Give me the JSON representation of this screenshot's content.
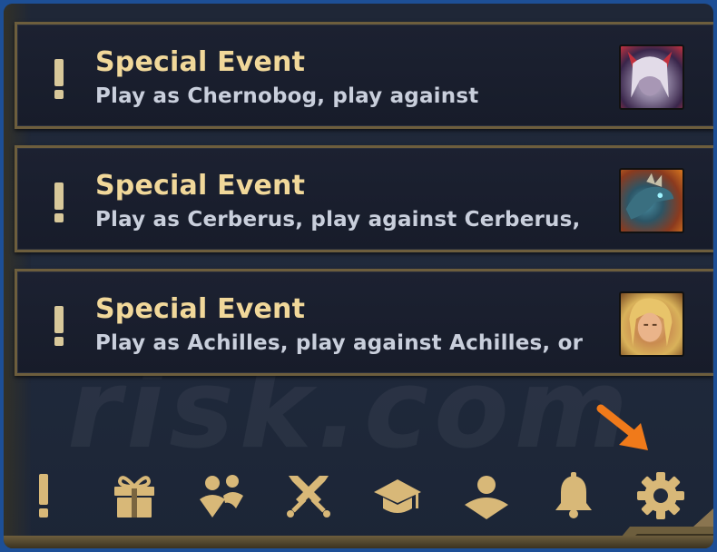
{
  "events": [
    {
      "title": "Special Event",
      "description": "Play as Chernobog, play against",
      "portrait": "chernobog-portrait"
    },
    {
      "title": "Special Event",
      "description": "Play as Cerberus, play against Cerberus,",
      "portrait": "cerberus-portrait"
    },
    {
      "title": "Special Event",
      "description": "Play as Achilles, play against Achilles, or",
      "portrait": "achilles-portrait"
    }
  ],
  "toolbar": [
    {
      "icon": "exclamation-icon"
    },
    {
      "icon": "gift-icon"
    },
    {
      "icon": "friends-icon"
    },
    {
      "icon": "crossed-swords-icon"
    },
    {
      "icon": "graduation-cap-icon"
    },
    {
      "icon": "profile-icon"
    },
    {
      "icon": "bell-icon"
    },
    {
      "icon": "gear-icon"
    }
  ],
  "colors": {
    "gold": "#f1d89a",
    "icon_gold": "#d8b878",
    "arrow": "#f07a1a",
    "border": "#6d5e3d"
  },
  "watermark": "risk.com"
}
